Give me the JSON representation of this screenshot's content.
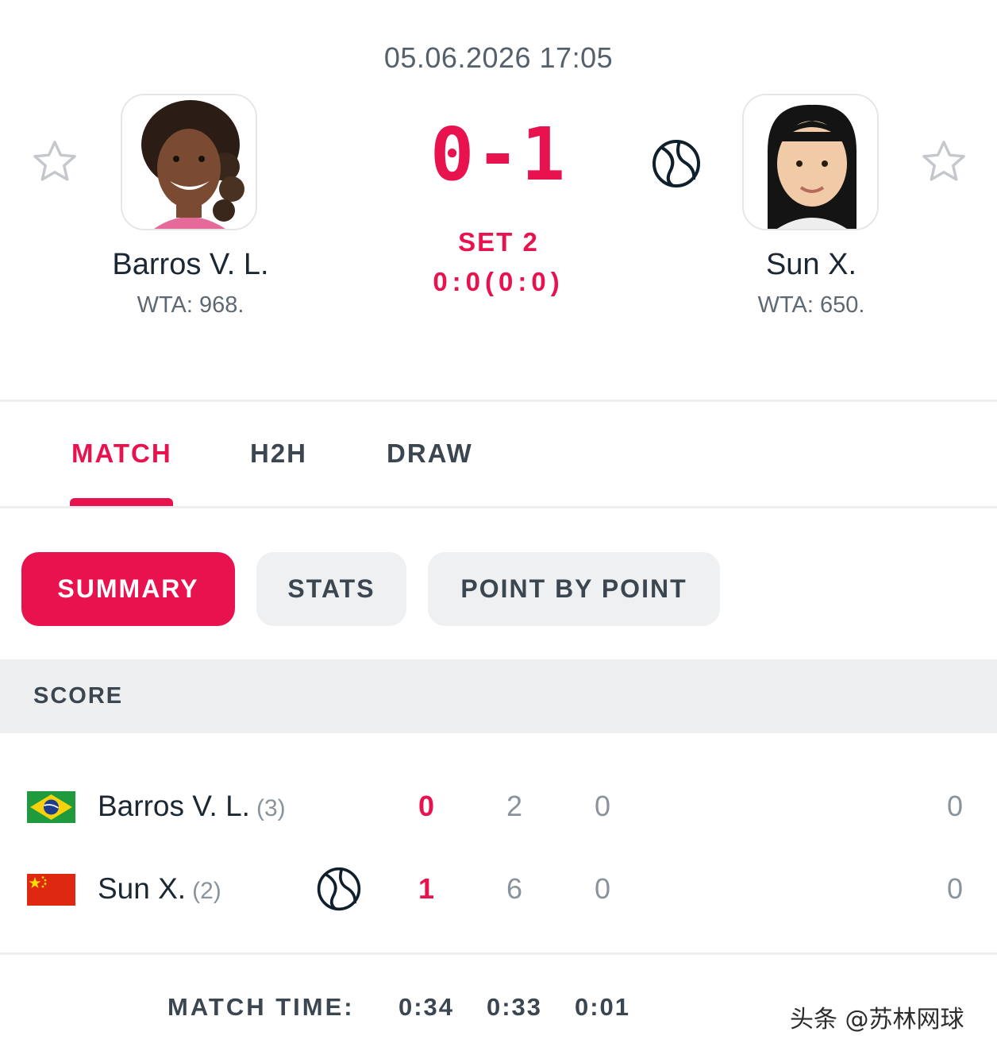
{
  "header": {
    "datetime": "05.06.2026 17:05",
    "big_score": "0-1",
    "set_label": "SET 2",
    "set_score": "0:0(0:0)"
  },
  "players": [
    {
      "name": "Barros V. L.",
      "ranking": "WTA: 968."
    },
    {
      "name": "Sun X.",
      "ranking": "WTA: 650."
    }
  ],
  "tabs": [
    {
      "label": "MATCH",
      "active": true
    },
    {
      "label": "H2H",
      "active": false
    },
    {
      "label": "DRAW",
      "active": false
    }
  ],
  "subtabs": [
    {
      "label": "SUMMARY",
      "active": true
    },
    {
      "label": "STATS",
      "active": false
    },
    {
      "label": "POINT BY POINT",
      "active": false
    }
  ],
  "score_section": {
    "title": "SCORE",
    "rows": [
      {
        "flag": "brazil-flag",
        "name": "Barros V. L.",
        "seed": "(3)",
        "serving": false,
        "sets": "0",
        "set1": "2",
        "set2": "0",
        "total": "0"
      },
      {
        "flag": "china-flag",
        "name": "Sun X.",
        "seed": "(2)",
        "serving": true,
        "sets": "1",
        "set1": "6",
        "set2": "0",
        "total": "0"
      }
    ]
  },
  "match_time": {
    "label": "MATCH TIME:",
    "values": [
      "0:34",
      "0:33",
      "0:01"
    ]
  },
  "watermark": "头条 @苏林网球",
  "colors": {
    "accent": "#e8124e",
    "pill_inactive": "#eff0f1",
    "section_header": "#eeeff0",
    "text_primary": "#1b2733",
    "text_muted": "#8a939b"
  },
  "icons": [
    "star-outline-icon",
    "tennis-ball-icon",
    "brazil-flag",
    "china-flag"
  ]
}
